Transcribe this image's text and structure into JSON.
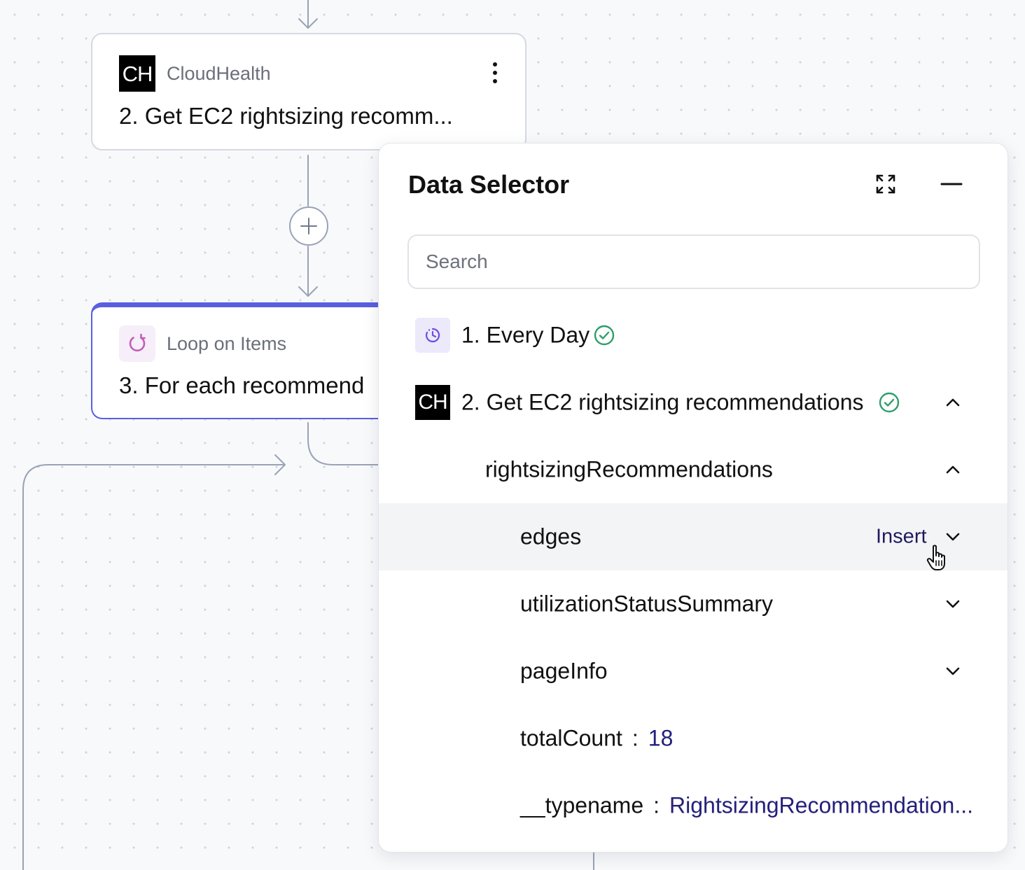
{
  "canvas": {
    "step2_card": {
      "app_logo": "CH",
      "app_name": "CloudHealth",
      "title": "2. Get EC2 rightsizing recomm..."
    },
    "step3_card": {
      "app_name": "Loop on Items",
      "title": "3. For each recommend"
    }
  },
  "panel": {
    "title": "Data Selector",
    "search_placeholder": "Search",
    "steps": [
      {
        "label": "1. Every Day",
        "status": "success"
      },
      {
        "logo": "CH",
        "label": "2. Get EC2 rightsizing recommendations",
        "status": "success",
        "expanded": true
      }
    ],
    "tree": {
      "group": "rightsizingRecommendations",
      "fields": [
        {
          "name": "edges",
          "action": "Insert"
        },
        {
          "name": "utilizationStatusSummary"
        },
        {
          "name": "pageInfo"
        }
      ],
      "values": [
        {
          "key": "totalCount",
          "sep": ":",
          "value": "18"
        },
        {
          "key": "__typename",
          "sep": ":",
          "value": "RightsizingRecommendation..."
        }
      ]
    }
  },
  "colors": {
    "accent": "#5a5fe0",
    "success": "#2f9e6a",
    "value_text": "#24207a",
    "connector": "#98a3b6"
  }
}
